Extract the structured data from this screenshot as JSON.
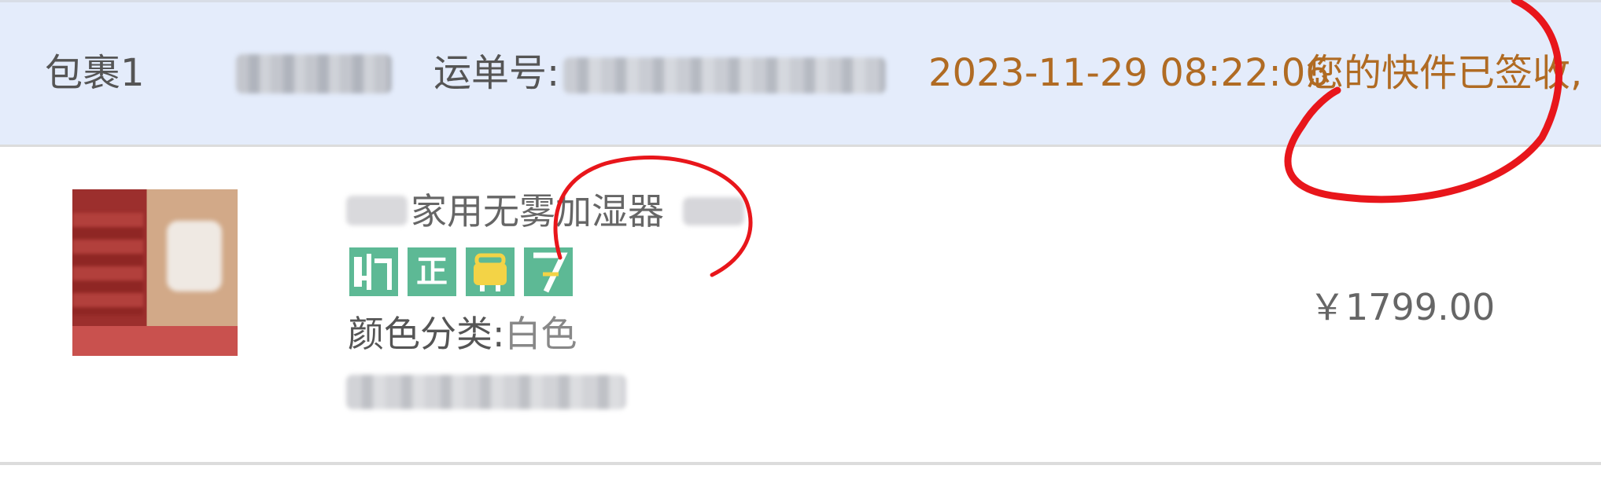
{
  "package": {
    "label": "包裹1",
    "tracking_label": "运单号:",
    "sign_time": "2023-11-29 08:22:06",
    "sign_status": "您的快件已签收,"
  },
  "product": {
    "title": "家用无雾加湿器",
    "badges": [
      "",
      "正",
      "",
      ""
    ],
    "sku_label": "颜色分类:",
    "sku_value": "白色",
    "price": "￥1799.00"
  },
  "colors": {
    "header_bg": "#e4ecfb",
    "status_text": "#b06b23",
    "badge_green": "#5db995",
    "annotation_red": "#e8161b"
  },
  "icons": [
    "truck-icon",
    "lock-icon",
    "bag-icon",
    "seven-day-icon"
  ]
}
